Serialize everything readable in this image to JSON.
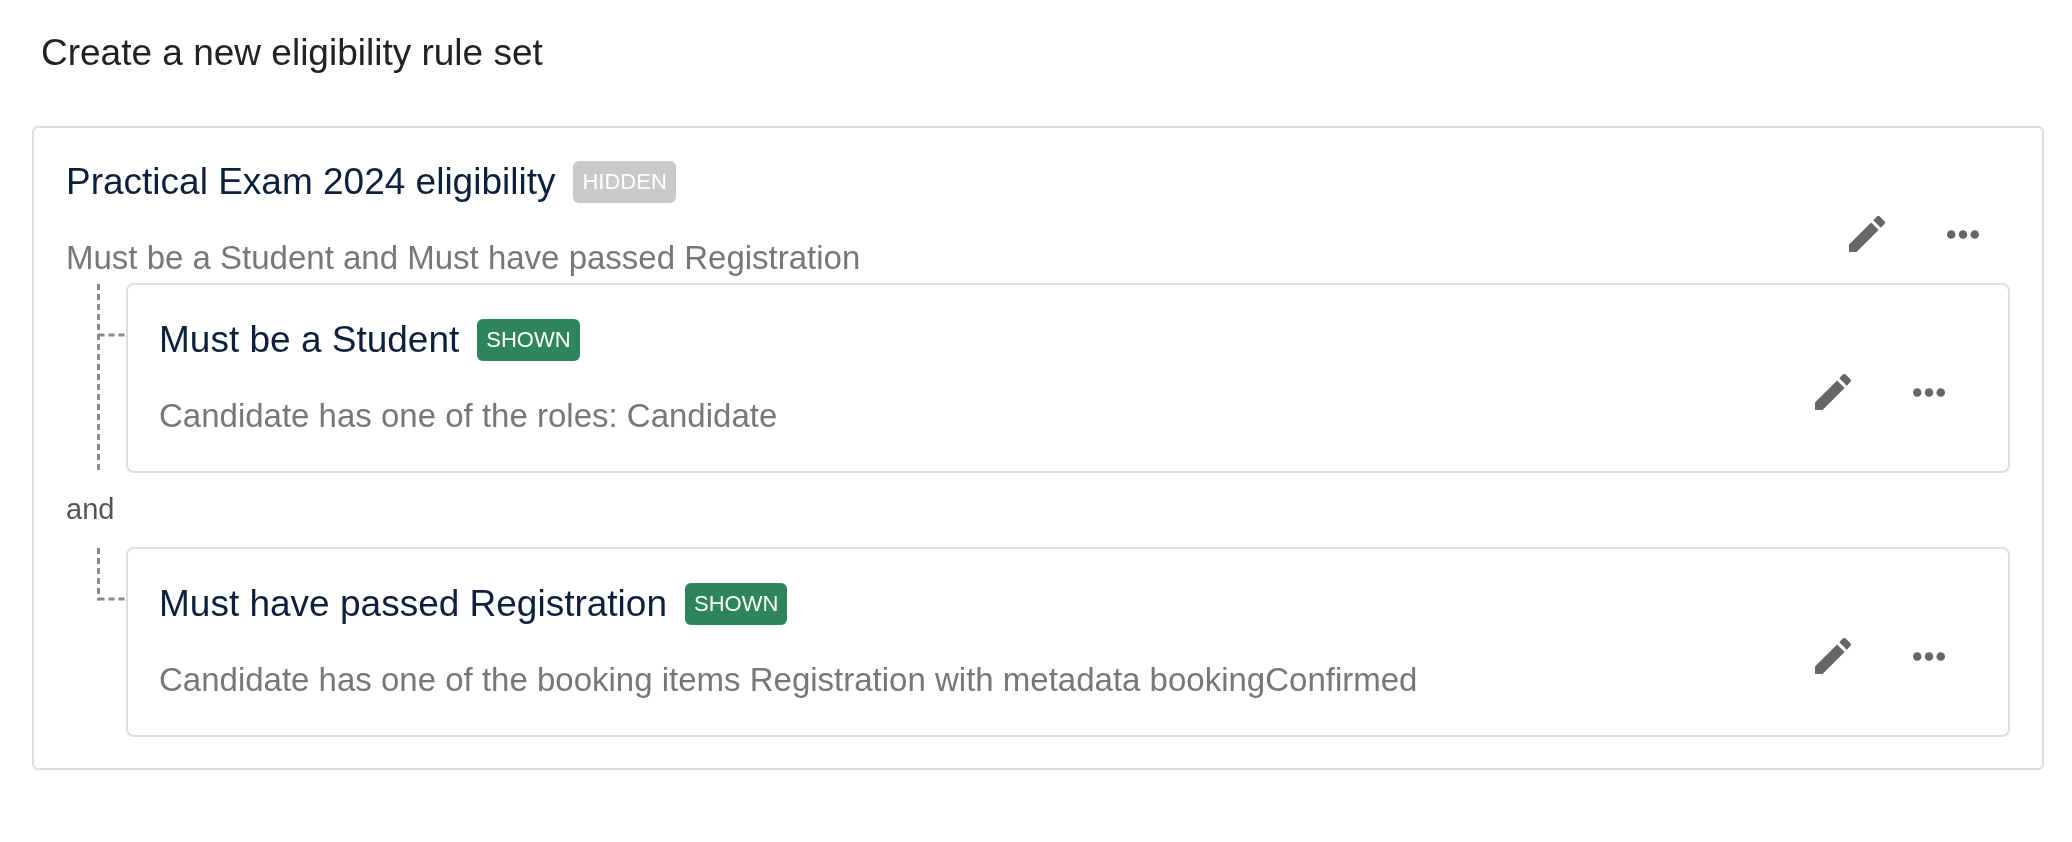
{
  "page": {
    "title": "Create a new eligibility rule set"
  },
  "rule_set": {
    "title": "Practical Exam 2024 eligibility",
    "badge": {
      "label": "HIDDEN",
      "visible": false
    },
    "summary": "Must be a Student and Must have passed Registration",
    "rules": [
      {
        "title": "Must be a Student",
        "badge": {
          "label": "SHOWN",
          "visible": true
        },
        "description": "Candidate has one of the roles: Candidate"
      },
      {
        "joiner": "and",
        "title": "Must have passed Registration",
        "badge": {
          "label": "SHOWN",
          "visible": true
        },
        "description": "Candidate has one of the booking items Registration with metadata bookingConfirmed"
      }
    ]
  }
}
